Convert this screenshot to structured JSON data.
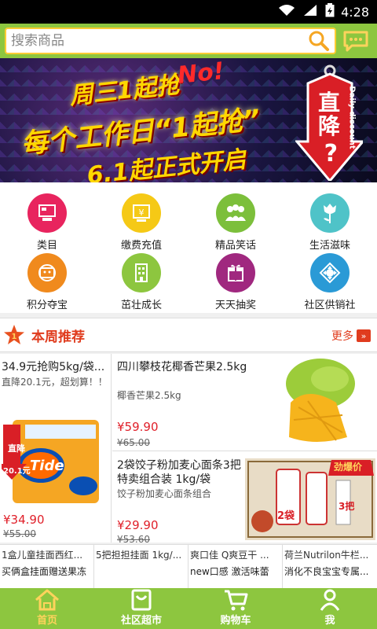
{
  "status": {
    "time": "4:28"
  },
  "search": {
    "placeholder": "搜索商品"
  },
  "banner": {
    "line1": "周三1起抢",
    "no": "No!",
    "line2": "每个工作日“1起抢”",
    "line3": "6.1起正式开启",
    "tag": "直降",
    "tag_q": "?",
    "tag_side": "Daily discount"
  },
  "menu": [
    {
      "label": "类目",
      "color": "#e8245e",
      "icon": "category-icon"
    },
    {
      "label": "缴费充值",
      "color": "#f5c916",
      "icon": "payment-icon"
    },
    {
      "label": "精品笑话",
      "color": "#7cbf3b",
      "icon": "people-icon"
    },
    {
      "label": "生活滋味",
      "color": "#4fc3c8",
      "icon": "flower-icon"
    },
    {
      "label": "积分夺宝",
      "color": "#f08a1d",
      "icon": "treasure-icon"
    },
    {
      "label": "茁壮成长",
      "color": "#8dc63f",
      "icon": "building-icon"
    },
    {
      "label": "天天抽奖",
      "color": "#a0287f",
      "icon": "gift-icon"
    },
    {
      "label": "社区供销社",
      "color": "#2a9ad6",
      "icon": "community-icon"
    }
  ],
  "section": {
    "title": "本周推荐",
    "more": "更多",
    "more_arrow": "»"
  },
  "products": {
    "left": {
      "title": "34.9元抢购5kg/袋...",
      "desc": "直降20.1元，超划算！！",
      "price": "¥34.90",
      "old": "¥55.00",
      "img_brand": "Tide",
      "img_tag": "直降",
      "img_amount": "20.1元"
    },
    "r1": {
      "title": "四川攀枝花椰香芒果2.5kg",
      "desc": "椰香芒果2.5kg",
      "price": "¥59.90",
      "old": "¥65.00"
    },
    "r2": {
      "title": "2袋饺子粉加麦心面条3把特卖组合装 1kg/袋",
      "desc": "饺子粉加麦心面条组合",
      "price": "¥29.90",
      "old": "¥53.60",
      "img_tag": "劲爆价",
      "img_a": "2袋",
      "img_b": "3把"
    }
  },
  "strip": [
    {
      "t1": "1盒儿童挂面西红...",
      "t2": "买俩盒挂面赠送果冻"
    },
    {
      "t1": "5把担担挂面 1kg/...",
      "t2": ""
    },
    {
      "t1": "爽口佳 Q爽豆干 ...",
      "t2": "new口感 激活味蕾"
    },
    {
      "t1": "荷兰Nutrilon牛栏...",
      "t2": "消化不良宝宝专属..."
    }
  ],
  "tabs": [
    {
      "label": "首页",
      "icon": "home-icon"
    },
    {
      "label": "社区超市",
      "icon": "market-icon"
    },
    {
      "label": "购物车",
      "icon": "cart-icon"
    },
    {
      "label": "我",
      "icon": "user-icon"
    }
  ],
  "colors": {
    "header_green": "#8dc63f",
    "accent_red": "#e03c1e",
    "active_tab": "#ffd35c"
  }
}
